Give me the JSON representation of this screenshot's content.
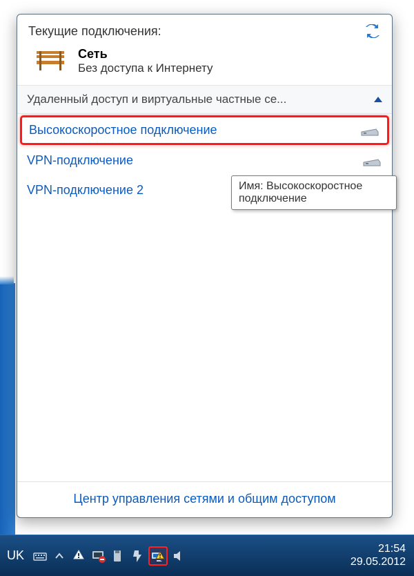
{
  "popup": {
    "title": "Текущие подключения:",
    "network": {
      "name": "Сеть",
      "status": "Без доступа к Интернету"
    },
    "section": {
      "label": "Удаленный доступ и виртуальные частные се..."
    },
    "connections": [
      {
        "label": "Высокоскоростное подключение",
        "icon": "modem-icon",
        "highlighted": true
      },
      {
        "label": "VPN-подключение",
        "icon": "modem-icon",
        "highlighted": false
      },
      {
        "label": "VPN-подключение 2",
        "icon": "server-icon",
        "highlighted": false
      }
    ],
    "tooltip": "Имя: Высокоскоростное подключение",
    "footer_link": "Центр управления сетями и общим доступом"
  },
  "taskbar": {
    "language": "UK",
    "time": "21:54",
    "date": "29.05.2012"
  }
}
